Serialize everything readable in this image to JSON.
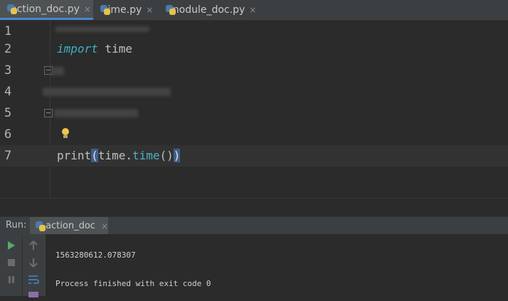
{
  "tabs": [
    {
      "label": "action_doc.py",
      "close": "×"
    },
    {
      "label": "time.py",
      "close": "×"
    },
    {
      "label": "module_doc.py",
      "close": "×"
    }
  ],
  "editor": {
    "line_numbers": [
      "1",
      "2",
      "3",
      "4",
      "5",
      "6",
      "7"
    ],
    "line2": {
      "keyword": "import",
      "rest": " time"
    },
    "line7": {
      "func": "print",
      "open": "(",
      "obj": "time.",
      "method": "time",
      "parens": "()",
      "close": ")"
    }
  },
  "run": {
    "label": "Run:",
    "tab_title": "action_doc",
    "tab_close": "×",
    "output_value": "1563280612.078307",
    "exit_message": "Process finished with exit code 0"
  },
  "icons": {
    "run": "play-icon",
    "stop": "stop-icon",
    "pause": "pause-icon",
    "up": "arrow-up-icon",
    "down": "arrow-down-icon",
    "wrap": "soft-wrap-icon",
    "print": "print-icon",
    "bulb": "lightbulb-icon"
  }
}
